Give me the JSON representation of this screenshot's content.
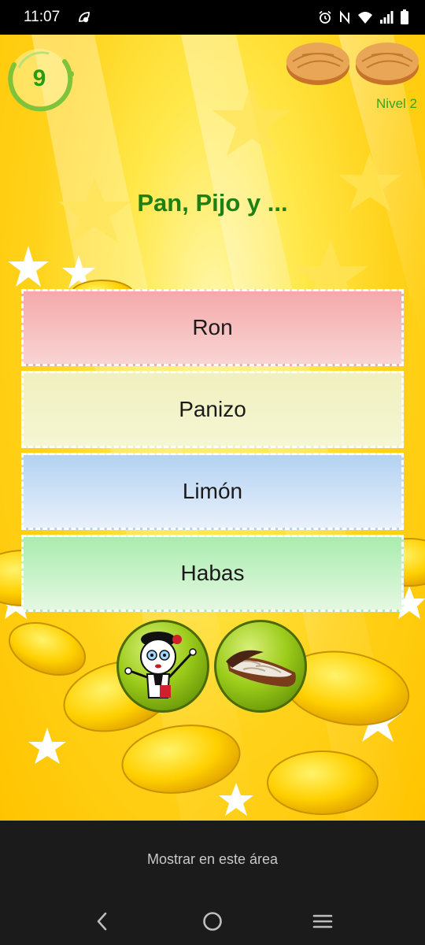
{
  "status_bar": {
    "time": "11:07",
    "left_icons": [
      "leaf-notification-icon"
    ],
    "right_icons": [
      "alarm-icon",
      "nfc-icon",
      "wifi-icon",
      "signal-icon",
      "battery-icon"
    ]
  },
  "game": {
    "timer": {
      "value": "9"
    },
    "lives": {
      "count": 2,
      "icon": "pie-life-icon"
    },
    "level_label": "Nivel 2",
    "question": "Pan, Pijo y ...",
    "answers": [
      {
        "label": "Ron"
      },
      {
        "label": "Panizo"
      },
      {
        "label": "Limón"
      },
      {
        "label": "Habas"
      }
    ],
    "helpers": [
      {
        "icon": "character-helper-icon"
      },
      {
        "icon": "sandwich-helper-icon"
      }
    ]
  },
  "ad_area": {
    "text": "Mostrar en este área"
  },
  "nav_bar": {
    "buttons": [
      "back-icon",
      "home-icon",
      "recents-icon"
    ]
  },
  "colors": {
    "question_text": "#1e7f12",
    "level_text": "#3aa51a",
    "answer_1_bg": "#f4a9aa",
    "answer_2_bg": "#f1f0c0",
    "answer_3_bg": "#b3d2f2",
    "answer_4_bg": "#a9ecae",
    "helper_button": "#9ccc1a"
  }
}
